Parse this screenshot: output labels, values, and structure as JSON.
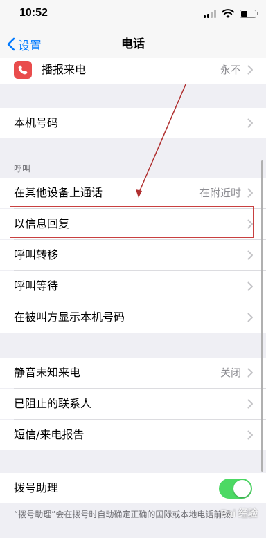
{
  "status_bar": {
    "time": "10:52"
  },
  "nav": {
    "back_label": "设置",
    "title": "电话"
  },
  "rows": {
    "announce_calls": {
      "label": "播报来电",
      "value": "永不"
    },
    "my_number": {
      "label": "本机号码"
    },
    "calls_other_devices": {
      "label": "在其他设备上通话",
      "value": "在附近时"
    },
    "respond_with_text": {
      "label": "以信息回复"
    },
    "call_forwarding": {
      "label": "呼叫转移"
    },
    "call_waiting": {
      "label": "呼叫等待"
    },
    "show_caller_id": {
      "label": "在被叫方显示本机号码"
    },
    "silence_unknown": {
      "label": "静音未知来电",
      "value": "关闭"
    },
    "blocked_contacts": {
      "label": "已阻止的联系人"
    },
    "sms_call_reporting": {
      "label": "短信/来电报告"
    },
    "dial_assist": {
      "label": "拨号助理"
    }
  },
  "sections": {
    "calls_header": "呼叫"
  },
  "dial_assist_footer": "“拨号助理”会在拨号时自动确定正确的国际或本地电话前缀。",
  "watermark": "Bai 经验",
  "colors": {
    "accent": "#007aff",
    "toggle_on": "#4cd964",
    "highlight": "#c84040"
  }
}
